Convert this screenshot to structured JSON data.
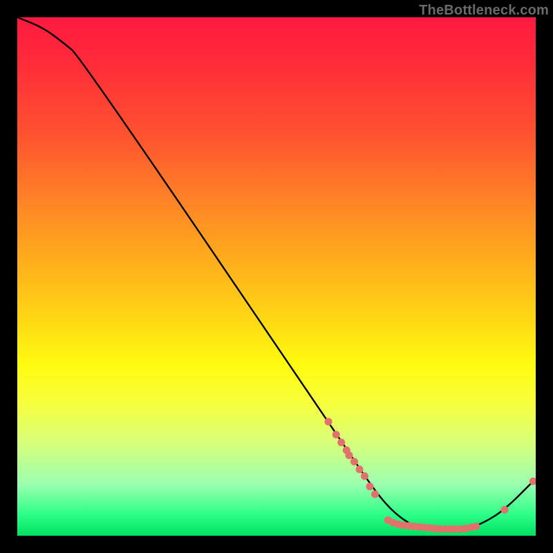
{
  "watermark": "TheBottleneck.com",
  "chart_data": {
    "type": "line",
    "title": "",
    "xlabel": "",
    "ylabel": "",
    "xlim": [
      0,
      100
    ],
    "ylim": [
      0,
      100
    ],
    "curve": [
      {
        "x": 0,
        "y": 100
      },
      {
        "x": 5,
        "y": 98
      },
      {
        "x": 9,
        "y": 95
      },
      {
        "x": 12,
        "y": 92.5
      },
      {
        "x": 60,
        "y": 22
      },
      {
        "x": 68,
        "y": 10
      },
      {
        "x": 72,
        "y": 5
      },
      {
        "x": 76,
        "y": 2
      },
      {
        "x": 80,
        "y": 1
      },
      {
        "x": 86,
        "y": 1
      },
      {
        "x": 90,
        "y": 2.5
      },
      {
        "x": 94,
        "y": 5
      },
      {
        "x": 100,
        "y": 11
      }
    ],
    "markers": [
      {
        "x": 60.0,
        "y": 22.0
      },
      {
        "x": 61.5,
        "y": 19.5
      },
      {
        "x": 62.5,
        "y": 18.0
      },
      {
        "x": 63.5,
        "y": 16.5
      },
      {
        "x": 64.0,
        "y": 15.5
      },
      {
        "x": 65.0,
        "y": 14.3
      },
      {
        "x": 66.0,
        "y": 12.8
      },
      {
        "x": 67.0,
        "y": 11.5
      },
      {
        "x": 68.0,
        "y": 9.5
      },
      {
        "x": 69.0,
        "y": 8.0
      },
      {
        "x": 71.5,
        "y": 3.0
      },
      {
        "x": 72.5,
        "y": 2.5
      },
      {
        "x": 73.5,
        "y": 2.2
      },
      {
        "x": 74.5,
        "y": 2.0
      },
      {
        "x": 75.5,
        "y": 1.9
      },
      {
        "x": 76.5,
        "y": 1.8
      },
      {
        "x": 77.5,
        "y": 1.7
      },
      {
        "x": 78.5,
        "y": 1.6
      },
      {
        "x": 79.5,
        "y": 1.5
      },
      {
        "x": 80.5,
        "y": 1.4
      },
      {
        "x": 81.5,
        "y": 1.3
      },
      {
        "x": 82.5,
        "y": 1.3
      },
      {
        "x": 83.5,
        "y": 1.3
      },
      {
        "x": 84.5,
        "y": 1.3
      },
      {
        "x": 85.5,
        "y": 1.3
      },
      {
        "x": 86.5,
        "y": 1.4
      },
      {
        "x": 87.5,
        "y": 1.6
      },
      {
        "x": 88.5,
        "y": 1.8
      },
      {
        "x": 94.0,
        "y": 5.0
      },
      {
        "x": 99.5,
        "y": 10.5
      }
    ],
    "colors": {
      "line": "#000000",
      "marker": "#e2706b"
    }
  }
}
